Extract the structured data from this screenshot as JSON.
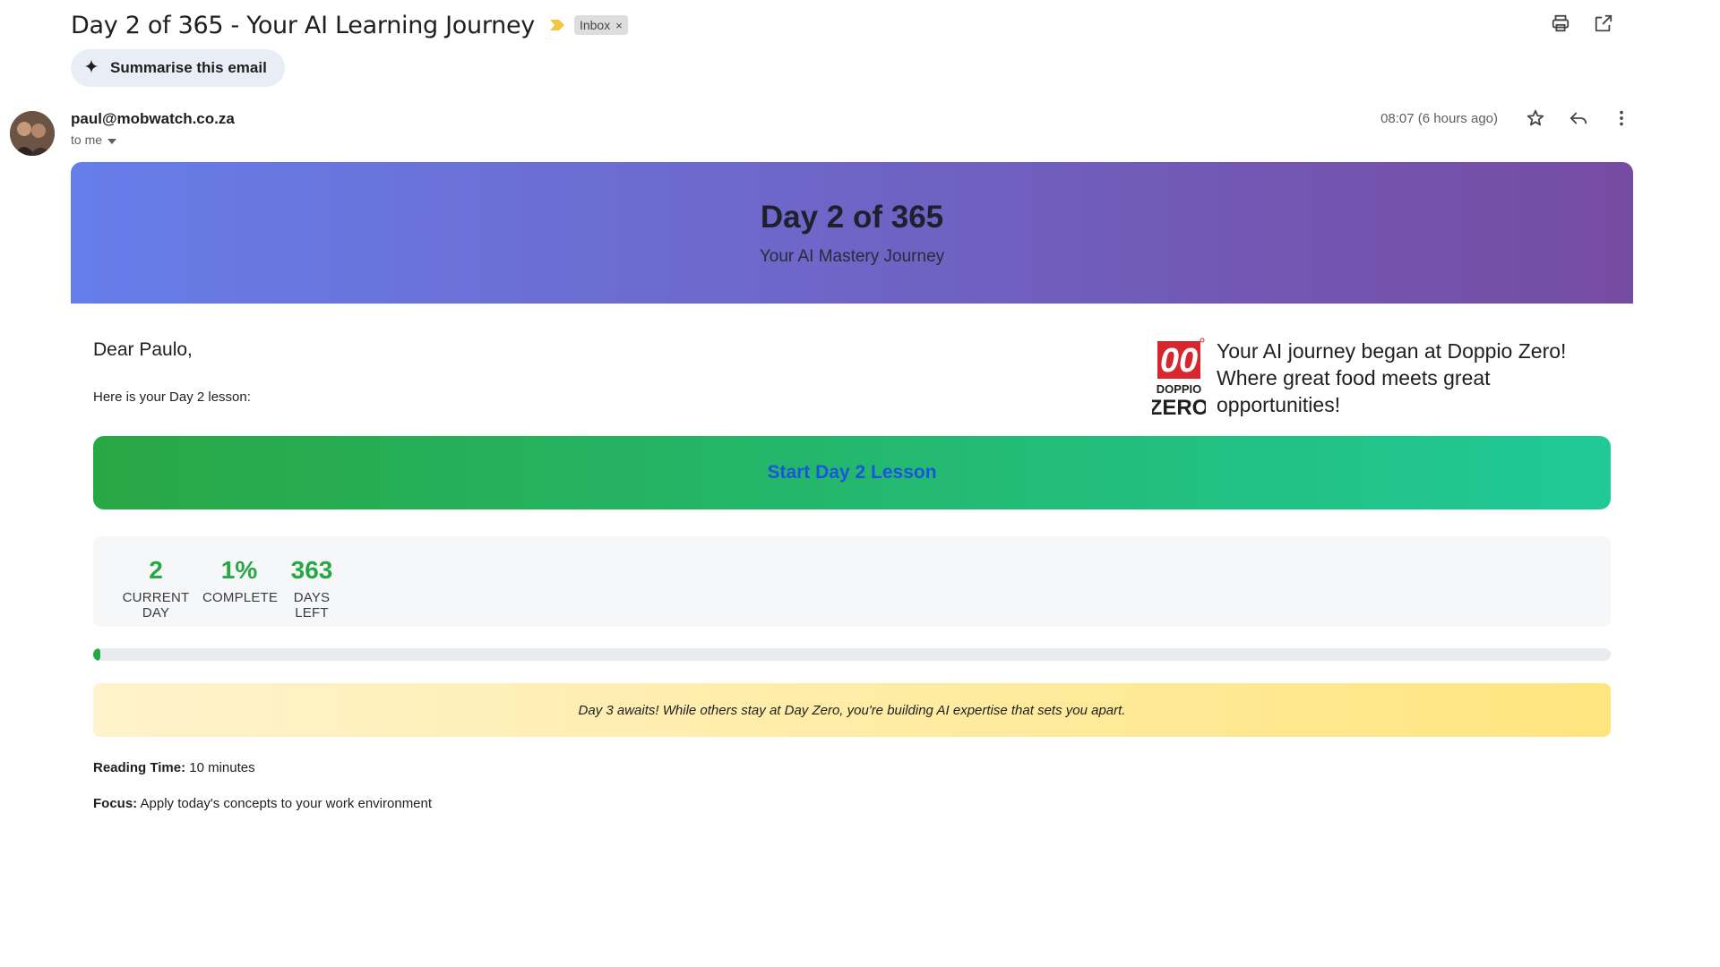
{
  "header": {
    "subject": "Day 2 of 365 - Your AI Learning Journey",
    "label_chip": "Inbox",
    "label_chip_close": "×",
    "summarise_label": "Summarise this email"
  },
  "sender": {
    "email": "paul@mobwatch.co.za",
    "recipient": "to me",
    "timestamp": "08:07 (6 hours ago)"
  },
  "email": {
    "hero_title": "Day 2 of 365",
    "hero_subtitle": "Your AI Mastery Journey",
    "greeting": "Dear Paulo,",
    "lesson_intro": "Here is your Day 2 lesson:",
    "promo": {
      "logo_top": "00",
      "logo_mid": "DOPPIO",
      "logo_bottom": "ZERO",
      "text": " Your AI journey began at Doppio Zero! Where great food meets great opportunities!"
    },
    "cta_label": "Start Day 2 Lesson",
    "stats": [
      {
        "value": "2",
        "label": "CURRENT DAY"
      },
      {
        "value": "1%",
        "label": "COMPLETE"
      },
      {
        "value": "363",
        "label": "DAYS LEFT"
      }
    ],
    "progress_percent": 0.5,
    "motivation": "Day 3 awaits! While others stay at Day Zero, you're building AI expertise that sets you apart.",
    "reading_time_label": "Reading Time:",
    "reading_time_value": " 10 minutes",
    "focus_label": "Focus:",
    "focus_value": " Apply today's concepts to your work environment"
  },
  "colors": {
    "hero_start": "#667eea",
    "hero_end": "#764ba2",
    "cta_start": "#28a745",
    "cta_end": "#20c997",
    "stat_value": "#28a745",
    "logo_red": "#d7262e"
  },
  "icons": {
    "importance": "importance-marker-icon",
    "print": "print-icon",
    "open_new_window": "open-in-new-window-icon",
    "sparkle": "sparkle-icon",
    "star": "star-icon",
    "reply": "reply-icon",
    "more": "more-vert-icon",
    "dropdown": "caret-down-icon"
  }
}
